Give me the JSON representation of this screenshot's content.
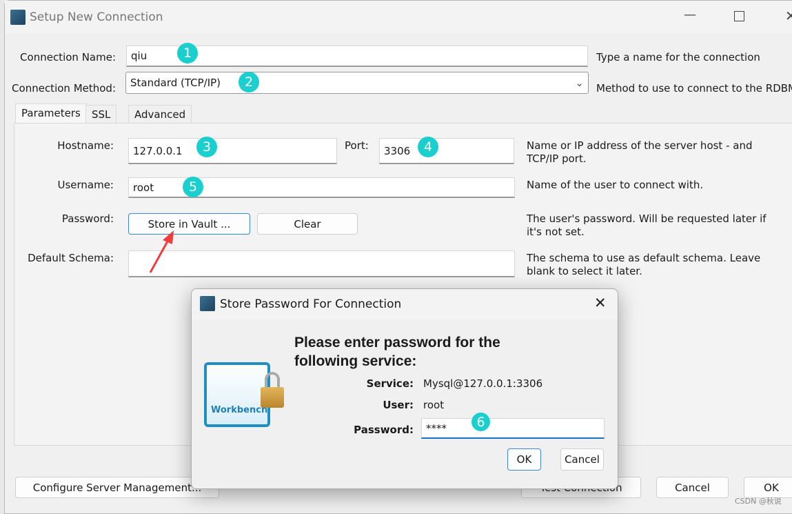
{
  "window": {
    "title": "Setup New Connection",
    "controls": [
      "minimize",
      "maximize",
      "close"
    ]
  },
  "connection_name": {
    "label": "Connection Name:",
    "value": "qiu",
    "hint": "Type a name for the connection"
  },
  "connection_method": {
    "label": "Connection Method:",
    "value": "Standard (TCP/IP)",
    "hint": "Method to use to connect to the RDBMS"
  },
  "tabs": [
    {
      "label": "Parameters",
      "active": true
    },
    {
      "label": "SSL"
    },
    {
      "label": "Advanced"
    }
  ],
  "params": {
    "hostname": {
      "label": "Hostname:",
      "value": "127.0.0.1"
    },
    "port": {
      "label": "Port:",
      "value": "3306"
    },
    "host_hint": "Name or IP address of the server host - and TCP/IP port.",
    "username": {
      "label": "Username:",
      "value": "root",
      "hint": "Name of the user to connect with."
    },
    "password": {
      "label": "Password:",
      "store_button": "Store in Vault ...",
      "clear_button": "Clear",
      "hint": "The user's password. Will be requested later if it's not set."
    },
    "schema": {
      "label": "Default Schema:",
      "value": "",
      "hint": "The schema to use as default schema. Leave blank to select it later."
    }
  },
  "footer": {
    "configure": "Configure Server Management...",
    "test": "Test Connection",
    "cancel": "Cancel",
    "ok": "OK"
  },
  "dialog": {
    "title": "Store Password For Connection",
    "heading": "Please enter password for the following service:",
    "service_label": "Service:",
    "service_value": "Mysql@127.0.0.1:3306",
    "user_label": "User:",
    "user_value": "root",
    "password_label": "Password:",
    "password_value": "****",
    "ok": "OK",
    "cancel": "Cancel",
    "logo_text": "MySQL Workbench"
  },
  "annotations": [
    "1",
    "2",
    "3",
    "4",
    "5",
    "6"
  ],
  "annotation_color": "#1bcfcf",
  "arrow_color": "#f03c3c",
  "watermark": "CSDN @秋说"
}
